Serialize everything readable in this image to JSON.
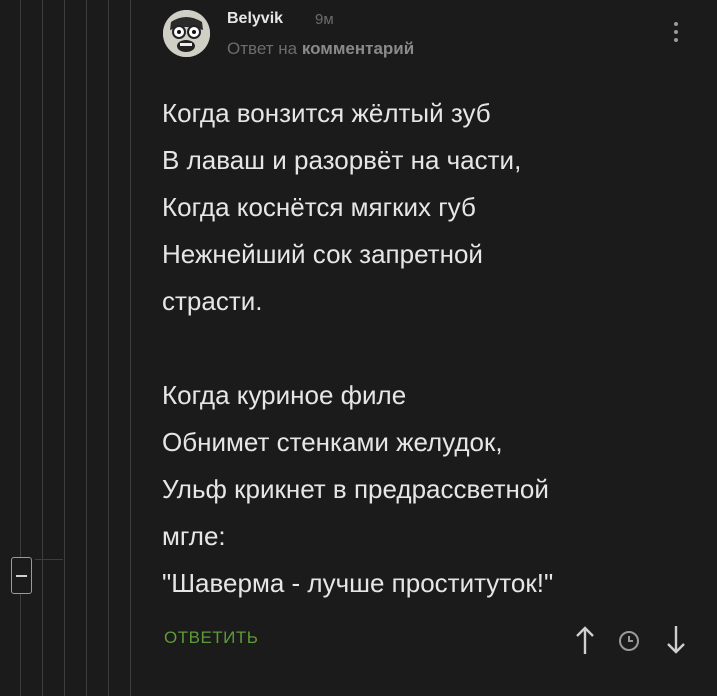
{
  "comment": {
    "author": "Belyvik",
    "time": "9м",
    "reply_prefix": "Ответ на",
    "reply_target": "комментарий",
    "body": "Когда вонзится жёлтый зуб\nВ лаваш и разорвёт на части,\nКогда коснётся мягких губ\nНежнейший сок запретной\nстрасти.\n\nКогда куриное филе\nОбнимет стенками желудок,\nУльф крикнет в предрассветной\nмгле:\n\"Шаверма - лучше проституток!\"",
    "reply_label": "ОТВЕТИТЬ"
  },
  "icons": [
    "more-vertical-icon",
    "collapse-icon",
    "arrow-up-icon",
    "clock-icon",
    "arrow-down-icon"
  ],
  "colors": {
    "background": "#1b1b1b",
    "text": "#e6e6e6",
    "muted": "#6c6c6c",
    "reply_accent": "#5f9a3a"
  }
}
